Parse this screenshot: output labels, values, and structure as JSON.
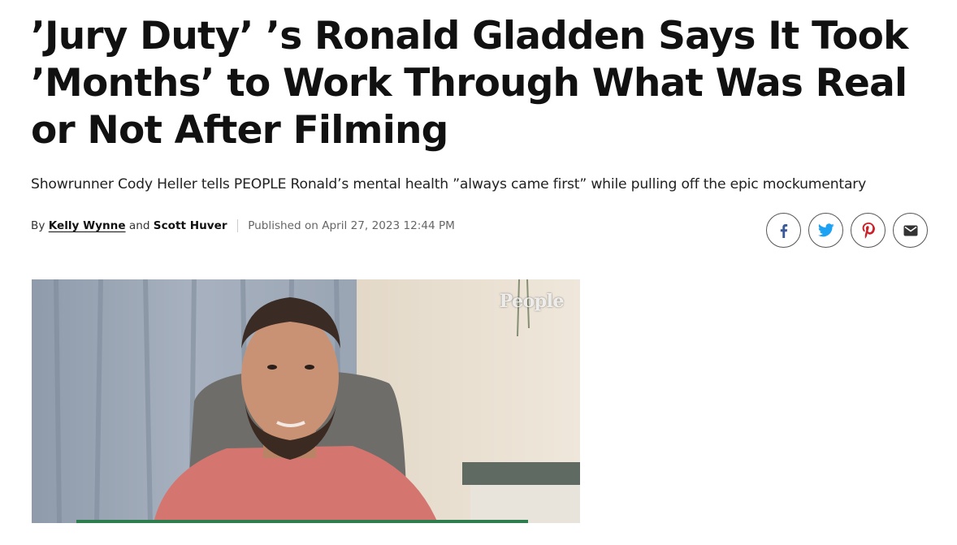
{
  "article": {
    "headline": "’Jury Duty’ ’s Ronald Gladden Says It Took ’Months’ to Work Through What Was Real or Not After Filming",
    "subhead": "Showrunner Cody Heller tells PEOPLE Ronald’s mental health ”always came first” while pulling off the epic mockumentary",
    "byline": {
      "by": "By",
      "author1": "Kelly Wynne",
      "and": "and",
      "author2": "Scott Huver",
      "published": "Published on April 27, 2023 12:44 PM"
    }
  },
  "share": {
    "buttons": [
      {
        "name": "facebook-icon",
        "color": "#3b5998"
      },
      {
        "name": "twitter-icon",
        "color": "#1da1f2"
      },
      {
        "name": "pinterest-icon",
        "color": "#cb2027"
      },
      {
        "name": "email-icon",
        "color": "#222222"
      }
    ]
  },
  "video": {
    "watermark": "People"
  },
  "colors": {
    "text": "#111111",
    "muted": "#666666",
    "icon_border": "#555555"
  }
}
